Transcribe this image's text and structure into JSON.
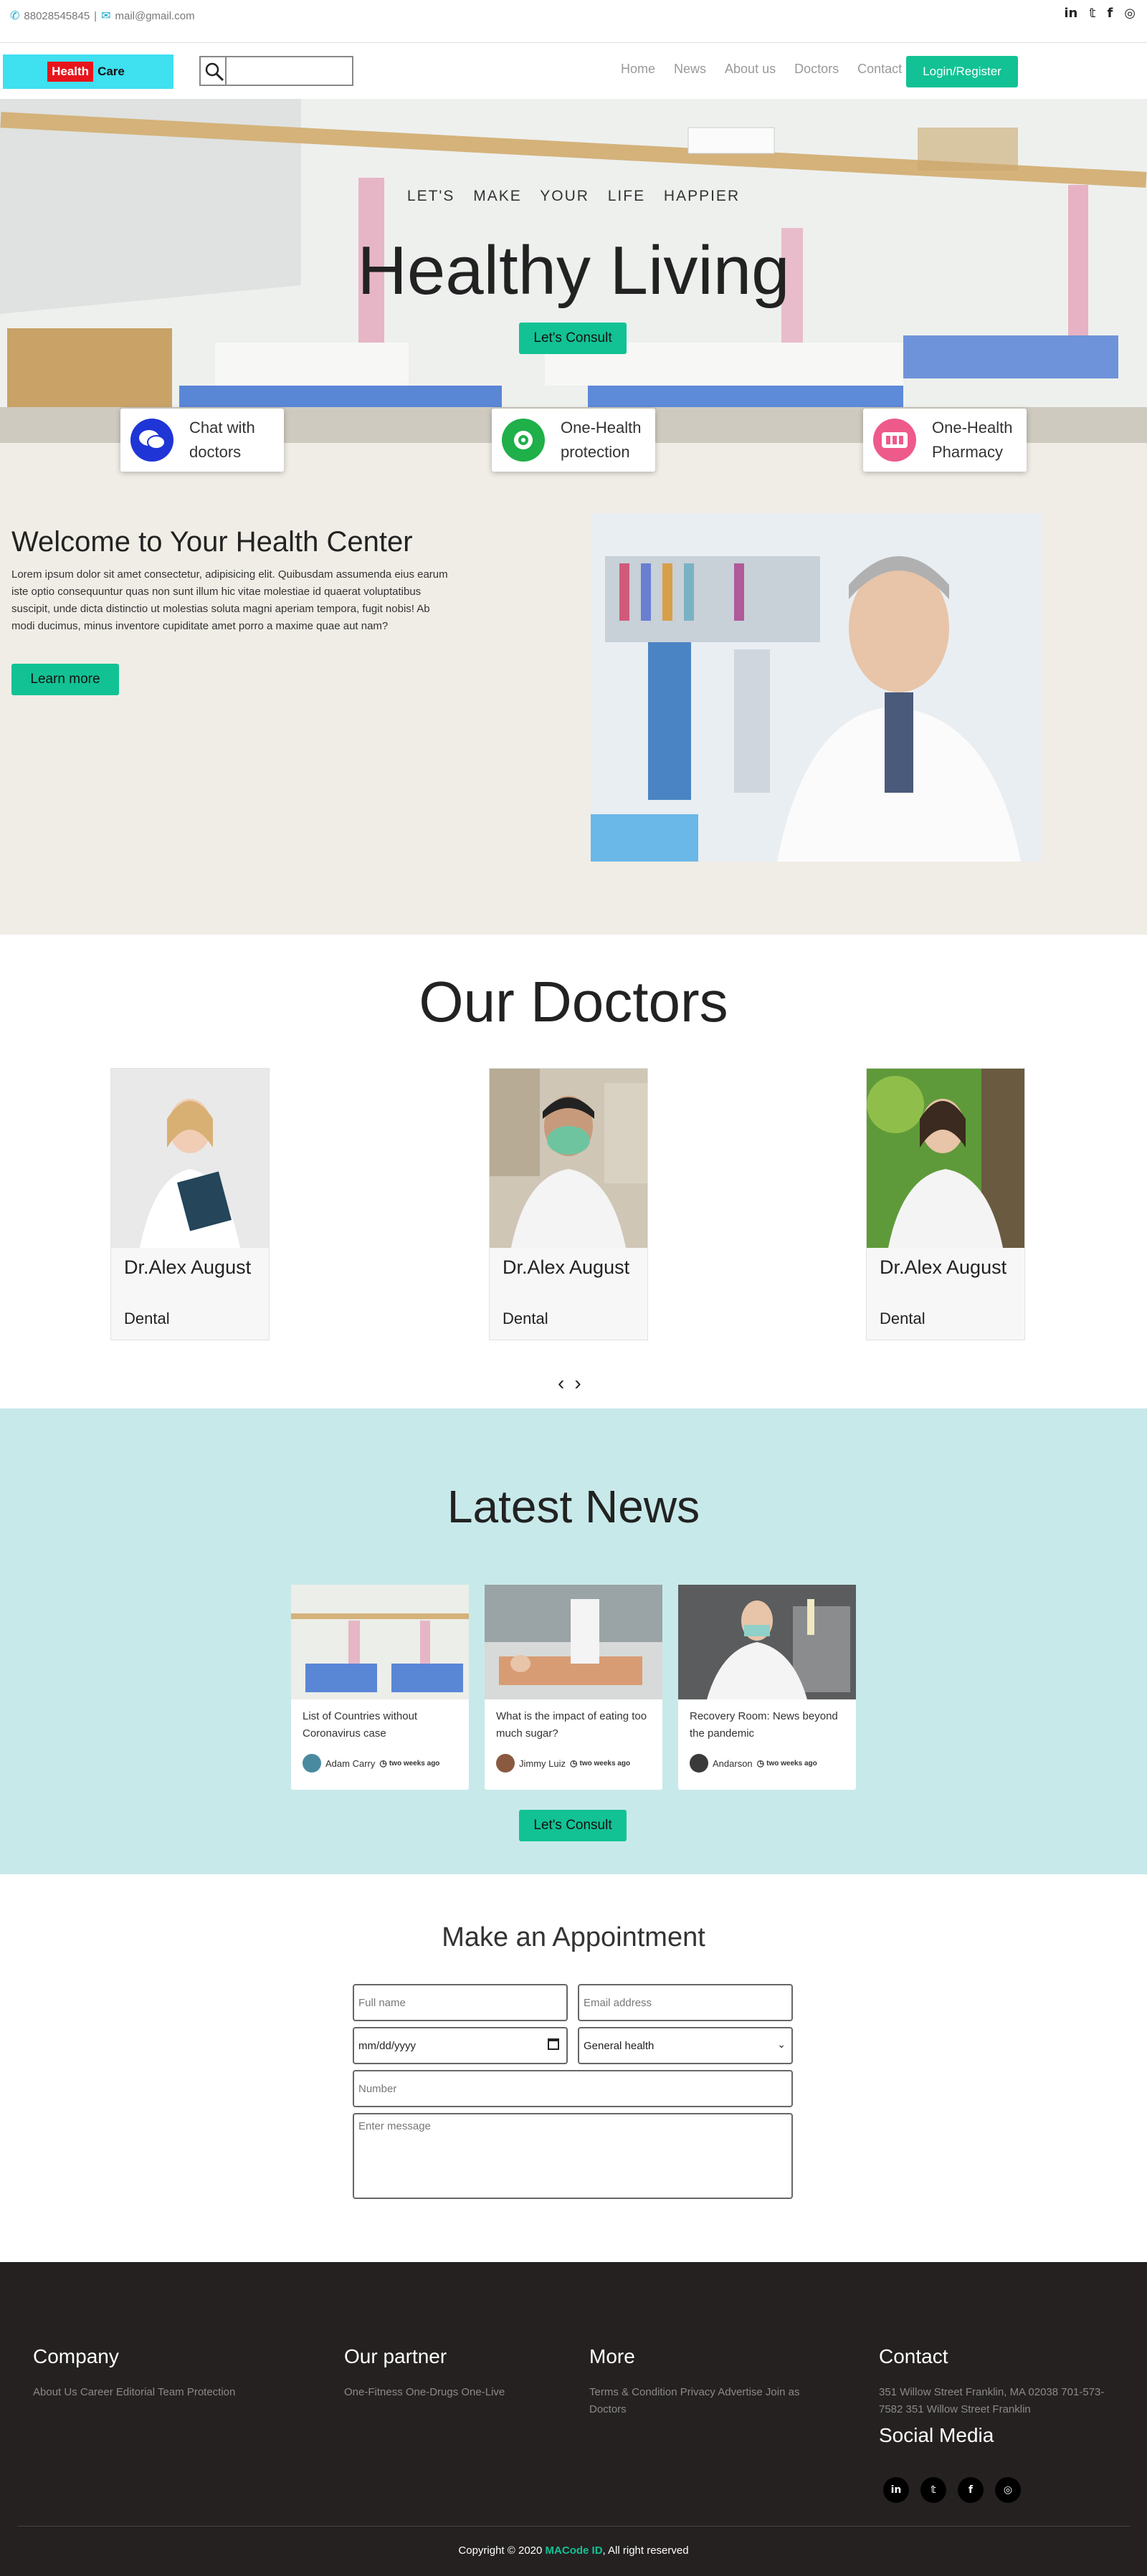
{
  "topbar": {
    "phone": "88028545845",
    "separator": "|",
    "email": "mail@gmail.com",
    "social": [
      "in",
      "𝕥",
      "f",
      "◎"
    ]
  },
  "navbar": {
    "logo_red": "Health",
    "logo_dark": "Care",
    "search_placeholder": "",
    "links": [
      "Home",
      "News",
      "About us",
      "Doctors",
      "Contact"
    ],
    "login_label": "Login/Register",
    "accent": "#12c294"
  },
  "hero": {
    "tagline": "LET'S MAKE YOUR LIFE HAPPIER",
    "title": "Healthy Living",
    "consult_label": "Let's Consult"
  },
  "features": [
    {
      "label": "Chat with doctors",
      "icon": "chat-icon",
      "color": "#1f35d6"
    },
    {
      "label": "One-Health protection",
      "icon": "virus-shield-icon",
      "color": "#1fb04a"
    },
    {
      "label": "One-Health Pharmacy",
      "icon": "pharmacy-icon",
      "color": "#ee5a8a"
    }
  ],
  "welcome": {
    "title": "Welcome to Your Health Center",
    "text": "Lorem ipsum dolor sit amet consectetur, adipisicing elit. Quibusdam assumenda eius earum iste optio consequuntur quas non sunt illum hic vitae molestiae id quaerat voluptatibus suscipit, unde dicta distinctio ut molestias soluta magni aperiam tempora, fugit nobis! Ab modi ducimus, minus inventore cupiditate amet porro a maxime quae aut nam?",
    "button": "Learn more"
  },
  "doctors": {
    "title": "Our Doctors",
    "items": [
      {
        "name": "Dr.Alex August",
        "specialty": "Dental"
      },
      {
        "name": "Dr.Alex August",
        "specialty": "Dental"
      },
      {
        "name": "Dr.Alex August",
        "specialty": "Dental"
      }
    ],
    "prev": "‹",
    "next": "›"
  },
  "news": {
    "title": "Latest News",
    "items": [
      {
        "title": "List of Countries without Coronavirus case",
        "author": "Adam Carry",
        "time": "two weeks ago"
      },
      {
        "title": "What is the impact of eating too much sugar?",
        "author": "Jimmy Luiz",
        "time": "two weeks ago"
      },
      {
        "title": "Recovery Room: News beyond the pandemic",
        "author": "Andarson",
        "time": "two weeks ago"
      }
    ],
    "button": "Let's Consult"
  },
  "appointment": {
    "title": "Make an Appointment",
    "fullname_placeholder": "Full name",
    "email_placeholder": "Email address",
    "date_placeholder": "mm/dd/yyyy",
    "select_value": "General health",
    "number_placeholder": "Number",
    "message_placeholder": "Enter message"
  },
  "footer": {
    "company": {
      "title": "Company",
      "links": "About Us Career Editorial Team Protection"
    },
    "partner": {
      "title": "Our partner",
      "links": "One-Fitness One-Drugs One-Live"
    },
    "more": {
      "title": "More",
      "links": "Terms & Condition Privacy Advertise Join as Doctors"
    },
    "contact": {
      "title": "Contact",
      "address": "351 Willow Street Franklin, MA 02038 701-573-7582 351 Willow Street Franklin"
    },
    "social_title": "Social Media",
    "social": [
      "in",
      "𝕥",
      "f",
      "◎"
    ],
    "copyright_pre": "Copyright © 2020 ",
    "copyright_brand": "MACode ID",
    "copyright_post": ", All right reserved"
  }
}
